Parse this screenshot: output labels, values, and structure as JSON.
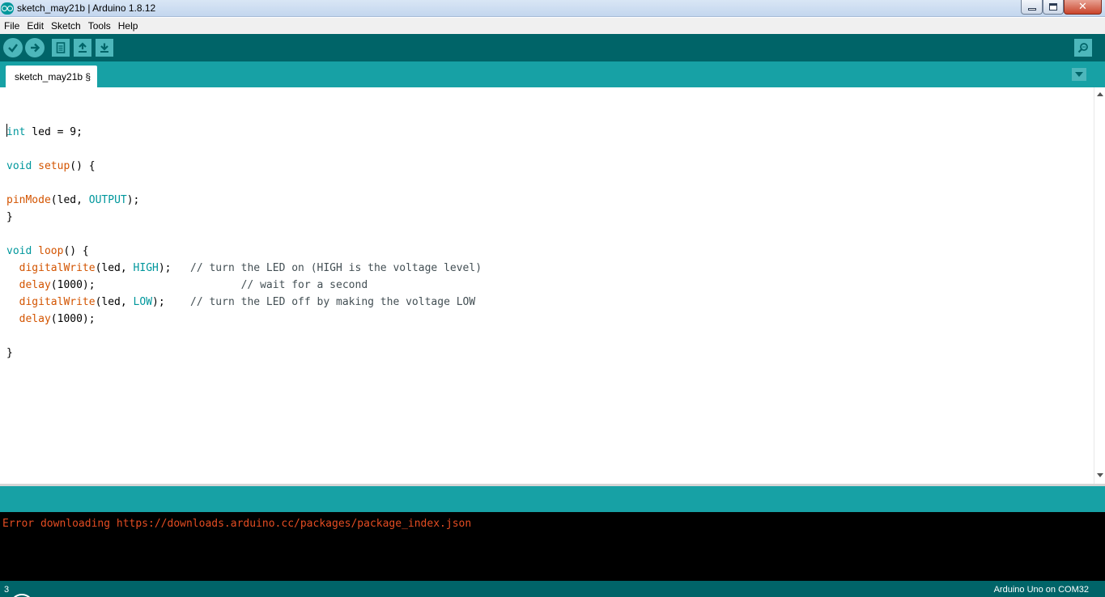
{
  "window": {
    "title": "sketch_may21b | Arduino 1.8.12"
  },
  "menu": {
    "items": [
      "File",
      "Edit",
      "Sketch",
      "Tools",
      "Help"
    ]
  },
  "toolbar": {
    "buttons": [
      "verify-icon",
      "upload-icon",
      "new-icon",
      "open-icon",
      "save-icon",
      "serial-monitor-icon"
    ]
  },
  "tabs": [
    {
      "label": "sketch_may21b §"
    }
  ],
  "editor": {
    "lines": {
      "l1_type": "int",
      "l1_rest": " led = 9;",
      "l3_type": "void",
      "l3_space": " ",
      "l3_func": "setup",
      "l3_rest": "() {",
      "l5_func": "pinMode",
      "l5_mid": "(led, ",
      "l5_const": "OUTPUT",
      "l5_rest": ");",
      "l6": "}",
      "l8_type": "void",
      "l8_space": " ",
      "l8_func": "loop",
      "l8_rest": "() {",
      "l9_indent": "  ",
      "l9_func": "digitalWrite",
      "l9_mid": "(led, ",
      "l9_const": "HIGH",
      "l9_rest": ");   ",
      "l9_comment": "// turn the LED on (HIGH is the voltage level)",
      "l10_indent": "  ",
      "l10_func": "delay",
      "l10_rest": "(1000);                       ",
      "l10_comment": "// wait for a second",
      "l11_indent": "  ",
      "l11_func": "digitalWrite",
      "l11_mid": "(led, ",
      "l11_const": "LOW",
      "l11_rest": ");    ",
      "l11_comment": "// turn the LED off by making the voltage LOW",
      "l12_indent": "  ",
      "l12_func": "delay",
      "l12_rest": "(1000);",
      "l14": "}"
    }
  },
  "console": {
    "error": "Error downloading https://downloads.arduino.cc/packages/package_index.json"
  },
  "status": {
    "line_number": "3",
    "board": "Arduino Uno on COM32"
  },
  "colors": {
    "toolbar": "#006468",
    "tabstrip": "#17a1a5",
    "keyword": "#00979c",
    "function": "#d35400",
    "error_text": "#e34c22"
  }
}
